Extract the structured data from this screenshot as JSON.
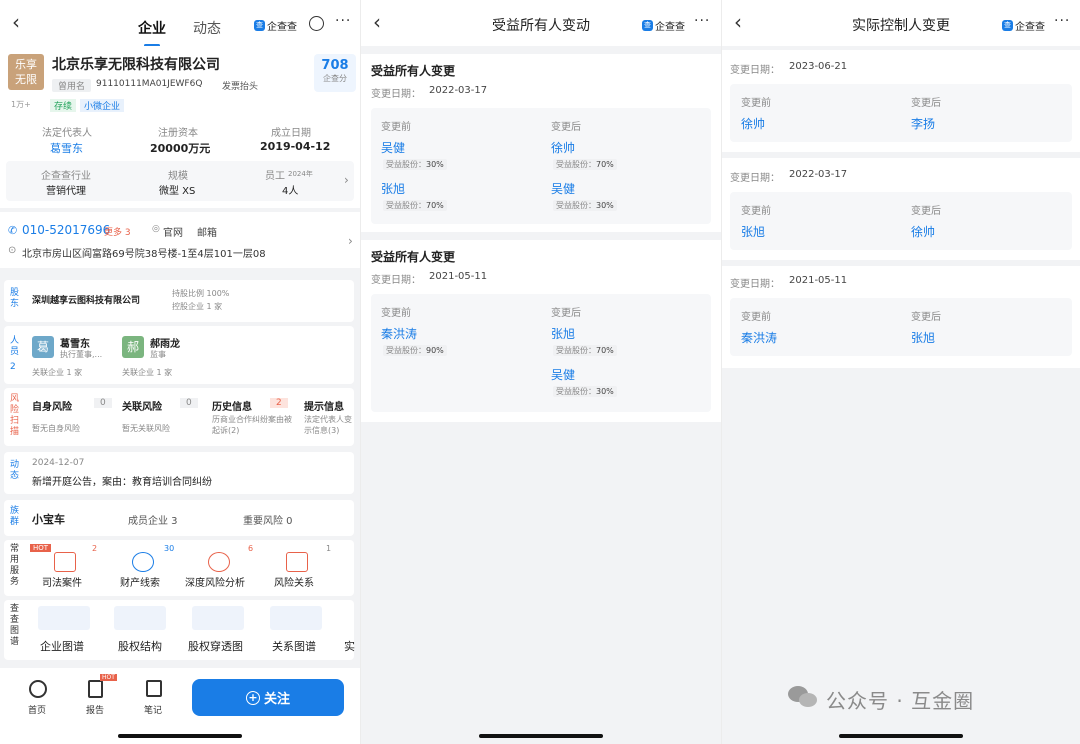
{
  "p1": {
    "tabs": [
      "企业",
      "动态"
    ],
    "qcc_label": "企查查",
    "qcc_badge": "查",
    "back_glyph": "‹",
    "search_glyph": "○",
    "more_glyph": "···",
    "logo_text": "乐享无限",
    "company_name": "北京乐享无限科技有限公司",
    "former_name_tag": "曾用名",
    "credit_code": "91110111MA01JEWF6Q",
    "invoice_link": "发票抬头",
    "view_count": "1万+",
    "status_tags": [
      "存续",
      "小微企业"
    ],
    "score_value": "708",
    "score_label": "企查分",
    "basic": [
      {
        "label": "法定代表人",
        "value": "葛雪东"
      },
      {
        "label": "注册资本",
        "value": "20000万元"
      },
      {
        "label": "成立日期",
        "value": "2019-04-12"
      }
    ],
    "basic2": [
      {
        "label": "企查查行业",
        "value": "营销代理"
      },
      {
        "label": "规模",
        "value": "微型 XS"
      },
      {
        "label": "员工",
        "sub": "2024年",
        "value": "4人"
      }
    ],
    "phone": "010-52017696",
    "phone_more": "更多 3",
    "website": "官网",
    "email": "邮箱",
    "address": "北京市房山区阎富路69号院38号楼-1至4层101一层08",
    "shareholder": {
      "label": "股东",
      "name": "深圳越享云图科技有限公司",
      "ratio": "持股比例 100%",
      "related": "控股企业 1 家"
    },
    "people": {
      "label": "人员",
      "count": "2",
      "list": [
        {
          "avatar": "葛",
          "name": "葛雪东",
          "role": "执行董事,...",
          "related": "关联企业 1 家"
        },
        {
          "avatar": "郝",
          "name": "郝雨龙",
          "role": "监事",
          "related": "关联企业 1 家"
        }
      ]
    },
    "risk": {
      "label": "风险扫描",
      "items": [
        {
          "title": "自身风险",
          "count": "0",
          "desc": "暂无自身风险"
        },
        {
          "title": "关联风险",
          "count": "0",
          "desc": "暂无关联风险"
        },
        {
          "title": "历史信息",
          "count": "2",
          "desc": "历商业合作纠纷案由被起诉(2)"
        },
        {
          "title": "提示信息",
          "count": "",
          "desc": "法定代表人变示信息(3)"
        }
      ]
    },
    "dynamic": {
      "label": "动态",
      "date": "2024-12-07",
      "text": "新增开庭公告，案由：教育培训合同纠纷"
    },
    "group": {
      "label": "族群",
      "name": "小宝车",
      "members": "成员企业 3",
      "risks": "重要风险 0"
    },
    "services": {
      "label": "常用服务",
      "hot": "HOT",
      "items": [
        {
          "name": "司法案件",
          "count": "2"
        },
        {
          "name": "财产线索",
          "count": "30"
        },
        {
          "name": "深度风险分析",
          "count": "6"
        },
        {
          "name": "风险关系",
          "count": "1"
        }
      ]
    },
    "graphs": {
      "label": "查查图谱",
      "items": [
        "企业图谱",
        "股权结构",
        "股权穿透图",
        "关系图谱",
        "实"
      ]
    },
    "bottom": {
      "home": "首页",
      "report": "报告",
      "report_hot": "HOT",
      "notes": "笔记",
      "follow": "关注"
    }
  },
  "p2": {
    "title": "受益所有人变动",
    "qcc_label": "企查查",
    "qcc_badge": "查",
    "back_glyph": "‹",
    "more_glyph": "···",
    "records": [
      {
        "heading": "受益所有人变更",
        "date_label": "变更日期：",
        "date": "2022-03-17",
        "before_label": "变更前",
        "after_label": "变更后",
        "before": [
          {
            "name": "吴健",
            "pct_label": "受益股份：",
            "pct": "30%"
          },
          {
            "name": "张旭",
            "pct_label": "受益股份：",
            "pct": "70%"
          }
        ],
        "after": [
          {
            "name": "徐帅",
            "pct_label": "受益股份：",
            "pct": "70%"
          },
          {
            "name": "吴健",
            "pct_label": "受益股份：",
            "pct": "30%"
          }
        ]
      },
      {
        "heading": "受益所有人变更",
        "date_label": "变更日期：",
        "date": "2021-05-11",
        "before_label": "变更前",
        "after_label": "变更后",
        "before": [
          {
            "name": "秦洪涛",
            "pct_label": "受益股份：",
            "pct": "90%"
          }
        ],
        "after": [
          {
            "name": "张旭",
            "pct_label": "受益股份：",
            "pct": "70%"
          },
          {
            "name": "吴健",
            "pct_label": "受益股份：",
            "pct": "30%"
          }
        ]
      }
    ]
  },
  "p3": {
    "title": "实际控制人变更",
    "qcc_label": "企查查",
    "qcc_badge": "查",
    "back_glyph": "‹",
    "more_glyph": "···",
    "records": [
      {
        "date_label": "变更日期：",
        "date": "2023-06-21",
        "before_label": "变更前",
        "after_label": "变更后",
        "before": "徐帅",
        "after": "李扬"
      },
      {
        "date_label": "变更日期：",
        "date": "2022-03-17",
        "before_label": "变更前",
        "after_label": "变更后",
        "before": "张旭",
        "after": "徐帅"
      },
      {
        "date_label": "变更日期：",
        "date": "2021-05-11",
        "before_label": "变更前",
        "after_label": "变更后",
        "before": "秦洪涛",
        "after": "张旭"
      }
    ],
    "watermark": "公众号 · 互金圈"
  }
}
